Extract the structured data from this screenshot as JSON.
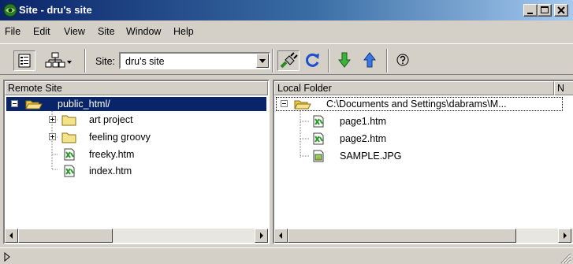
{
  "window": {
    "title": "Site - dru's site"
  },
  "menu": [
    "File",
    "Edit",
    "View",
    "Site",
    "Window",
    "Help"
  ],
  "toolbar": {
    "site_label": "Site:",
    "site_value": "dru's site",
    "buttons": [
      "site-files-view",
      "site-map-view",
      "connect",
      "refresh",
      "get",
      "put",
      "help"
    ]
  },
  "remote": {
    "header": "Remote Site",
    "root": "public_html/",
    "items": [
      {
        "label": "art project",
        "type": "folder"
      },
      {
        "label": "feeling groovy",
        "type": "folder"
      },
      {
        "label": "freeky.htm",
        "type": "file"
      },
      {
        "label": "index.htm",
        "type": "file"
      }
    ]
  },
  "local": {
    "header": "Local Folder",
    "header2": "N",
    "root": "C:\\Documents and Settings\\dabrams\\M...",
    "items": [
      {
        "label": "page1.htm",
        "type": "file"
      },
      {
        "label": "page2.htm",
        "type": "file"
      },
      {
        "label": "SAMPLE.JPG",
        "type": "image"
      }
    ]
  },
  "colors": {
    "title_start": "#0a246a",
    "selection": "#0a246a",
    "face": "#d4d0c8"
  }
}
